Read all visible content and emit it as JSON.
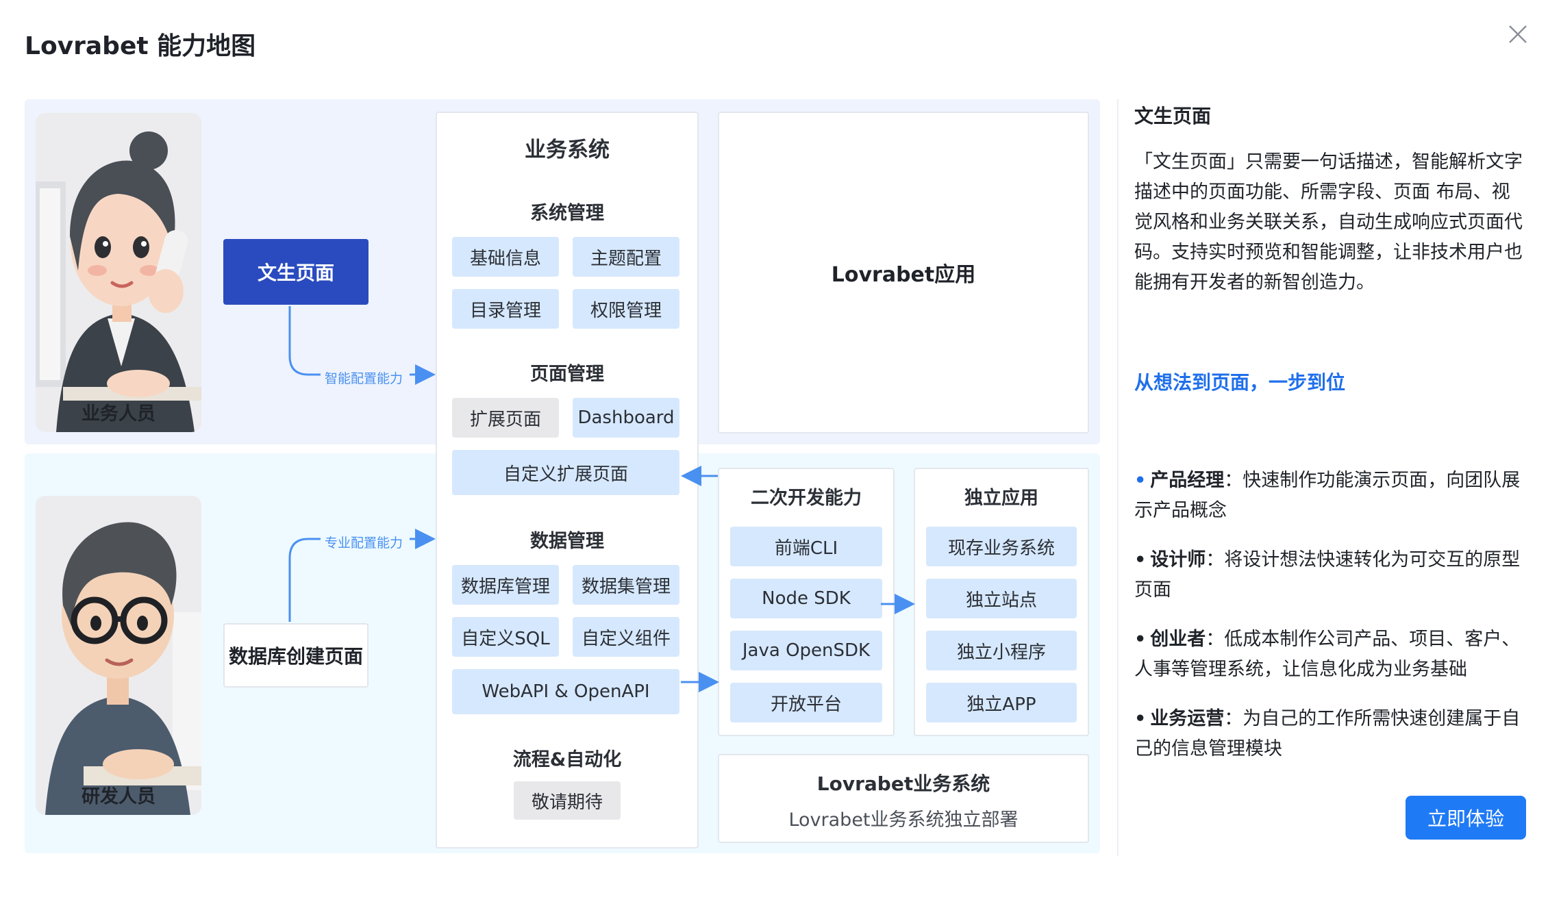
{
  "modal": {
    "title": "Lovrabet 能力地图"
  },
  "personas": {
    "business": "业务人员",
    "developer": "研发人员"
  },
  "actions": {
    "text_page": "文生页面",
    "db_page": "数据库创建页面"
  },
  "flows": {
    "smart_config": "智能配置能力",
    "pro_config": "专业配置能力"
  },
  "biz_system": {
    "title": "业务系统",
    "system_mgmt": {
      "title": "系统管理",
      "items": [
        "基础信息",
        "主题配置",
        "目录管理",
        "权限管理"
      ]
    },
    "page_mgmt": {
      "title": "页面管理",
      "items": [
        "扩展页面",
        "Dashboard"
      ],
      "wide": "自定义扩展页面"
    },
    "data_mgmt": {
      "title": "数据管理",
      "items": [
        "数据库管理",
        "数据集管理",
        "自定义SQL",
        "自定义组件"
      ],
      "wide": "WebAPI & OpenAPI"
    },
    "workflow": {
      "title": "流程&自动化",
      "item": "敬请期待"
    }
  },
  "lovrabet_app": {
    "title": "Lovrabet应用"
  },
  "dev_ability": {
    "title": "二次开发能力",
    "items": [
      "前端CLI",
      "Node SDK",
      "Java OpenSDK",
      "开放平台"
    ]
  },
  "standalone": {
    "title": "独立应用",
    "items": [
      "现存业务系统",
      "独立站点",
      "独立小程序",
      "独立APP"
    ]
  },
  "deploy": {
    "title": "Lovrabet业务系统",
    "subtitle": "Lovrabet业务系统独立部署"
  },
  "side": {
    "title": "文生页面",
    "description": "「文生页面」只需要一句话描述，智能解析文字描述中的页面功能、所需字段、页面 布局、视觉风格和业务关联关系，自动生成响应式页面代码。支持实时预览和智能调整，让非技术用户也能拥有开发者的新智创造力。",
    "slogan": "从想法到页面，一步到位",
    "bullets": [
      {
        "role": "产品经理",
        "text": "：快速制作功能演示页面，向团队展示产品概念"
      },
      {
        "role": "设计师",
        "text": "：将设计想法快速转化为可交互的原型页面"
      },
      {
        "role": "创业者",
        "text": "：低成本制作公司产品、项目、客户、人事等管理系统，让信息化成为业务基础"
      },
      {
        "role": "业务运营",
        "text": "：为自己的工作所需快速创建属于自己的信息管理模块"
      }
    ],
    "cta": "立即体验"
  },
  "colors": {
    "primary": "#2a4bbf",
    "accent": "#1f7af5",
    "chip": "#d6e8fd",
    "chip_grey": "#e8e8ea",
    "arrow": "#4a90f0"
  },
  "icons": {
    "close": "close-icon"
  }
}
